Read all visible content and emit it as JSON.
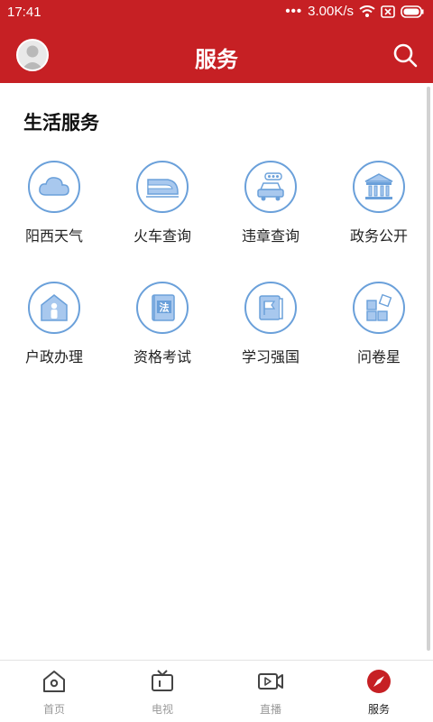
{
  "status": {
    "time": "17:41",
    "network_speed": "3.00K/s"
  },
  "header": {
    "title": "服务"
  },
  "section": {
    "title": "生活服务"
  },
  "services": [
    {
      "label": "阳西天气",
      "icon": "cloud-icon"
    },
    {
      "label": "火车查询",
      "icon": "train-icon"
    },
    {
      "label": "违章查询",
      "icon": "car-icon"
    },
    {
      "label": "政务公开",
      "icon": "government-building-icon"
    },
    {
      "label": "户政办理",
      "icon": "household-icon"
    },
    {
      "label": "资格考试",
      "icon": "law-book-icon"
    },
    {
      "label": "学习强国",
      "icon": "flag-book-icon"
    },
    {
      "label": "问卷星",
      "icon": "blocks-icon"
    }
  ],
  "bottom_nav": {
    "items": [
      {
        "label": "首页",
        "icon": "home-icon"
      },
      {
        "label": "电视",
        "icon": "tv-icon"
      },
      {
        "label": "直播",
        "icon": "live-video-icon"
      },
      {
        "label": "服务",
        "icon": "compass-icon",
        "active": true
      }
    ]
  },
  "colors": {
    "brand": "#c62024",
    "icon_blue": "#6aa0da"
  }
}
